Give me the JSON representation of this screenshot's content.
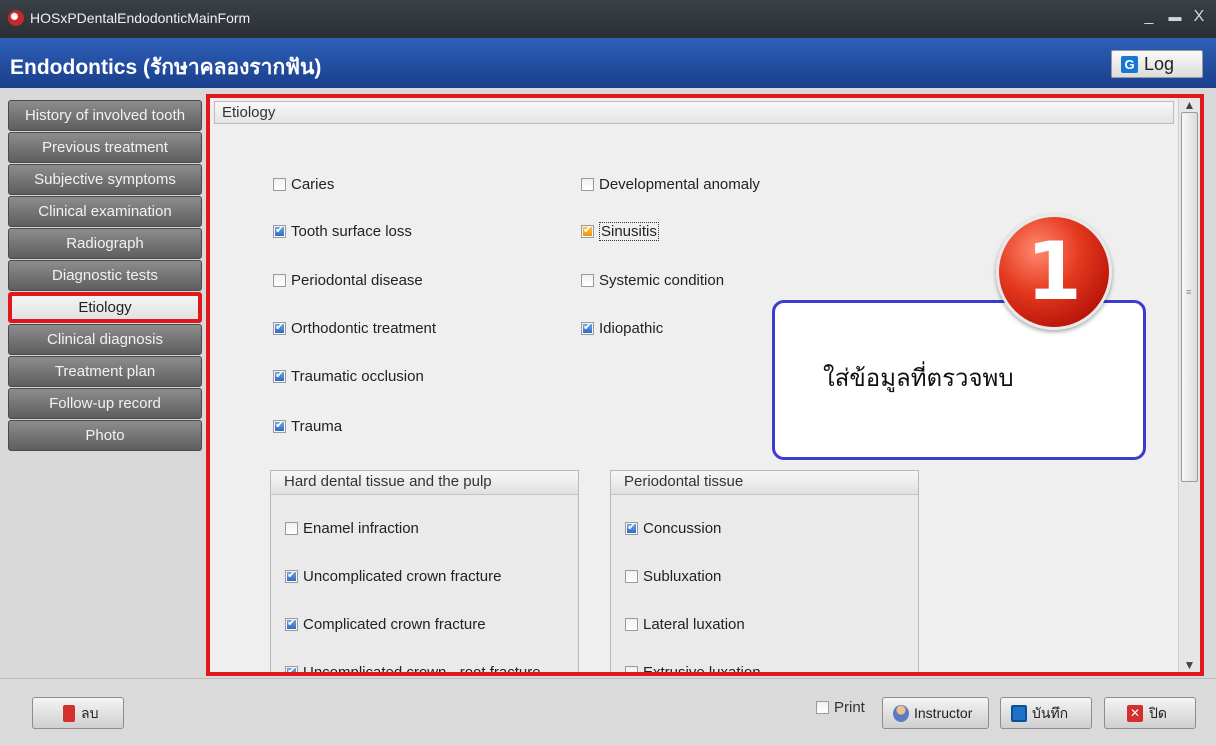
{
  "window": {
    "title": "HOSxPDentalEndodonticMainForm",
    "minimize": "_",
    "maximize": "▬",
    "close": "X"
  },
  "header": {
    "title": "Endodontics (รักษาคลองรากฟัน)",
    "log_label": "Log"
  },
  "sidebar": {
    "items": [
      {
        "label": "History of involved tooth",
        "active": false
      },
      {
        "label": "Previous treatment",
        "active": false
      },
      {
        "label": "Subjective symptoms",
        "active": false
      },
      {
        "label": "Clinical examination",
        "active": false
      },
      {
        "label": "Radiograph",
        "active": false
      },
      {
        "label": "Diagnostic tests",
        "active": false
      },
      {
        "label": "Etiology",
        "active": true
      },
      {
        "label": "Clinical diagnosis",
        "active": false
      },
      {
        "label": "Treatment plan",
        "active": false
      },
      {
        "label": "Follow-up record",
        "active": false
      },
      {
        "label": "Photo",
        "active": false
      }
    ]
  },
  "panel": {
    "title": "Etiology",
    "left_options": [
      {
        "label": "Caries",
        "checked": false
      },
      {
        "label": "Tooth surface loss",
        "checked": true
      },
      {
        "label": "Periodontal disease",
        "checked": false
      },
      {
        "label": "Orthodontic treatment",
        "checked": true
      },
      {
        "label": "Traumatic occlusion",
        "checked": true
      },
      {
        "label": "Trauma",
        "checked": true
      }
    ],
    "right_options": [
      {
        "label": "Developmental anomaly",
        "checked": false
      },
      {
        "label": "Sinusitis",
        "checked": true
      },
      {
        "label": "Systemic condition",
        "checked": false
      },
      {
        "label": "Idiopathic",
        "checked": true
      }
    ],
    "hard_tissue": {
      "title": "Hard dental tissue and the pulp",
      "items": [
        {
          "label": "Enamel infraction",
          "checked": false
        },
        {
          "label": "Uncomplicated crown fracture",
          "checked": true
        },
        {
          "label": "Complicated crown fracture",
          "checked": true
        },
        {
          "label": "Uncomplicated crown - root fracture",
          "checked": true
        }
      ]
    },
    "periodontal": {
      "title": "Periodontal tissue",
      "items": [
        {
          "label": "Concussion",
          "checked": true
        },
        {
          "label": "Subluxation",
          "checked": false
        },
        {
          "label": "Lateral luxation",
          "checked": false
        },
        {
          "label": "Extrusive luxation",
          "checked": false
        }
      ]
    }
  },
  "annotation": {
    "step": "1",
    "text": "ใส่ข้อมูลที่ตรวจพบ"
  },
  "footer": {
    "delete_label": "ลบ",
    "print_label": "Print",
    "print_checked": false,
    "instructor_label": "Instructor",
    "save_label": "บันทึก",
    "close_label": "ปิด"
  },
  "colors": {
    "accent_red": "#e0181d",
    "header_blue": "#1a3f8c",
    "checkbox_blue": "#2f6cc2",
    "checkbox_orange": "#f29100"
  }
}
